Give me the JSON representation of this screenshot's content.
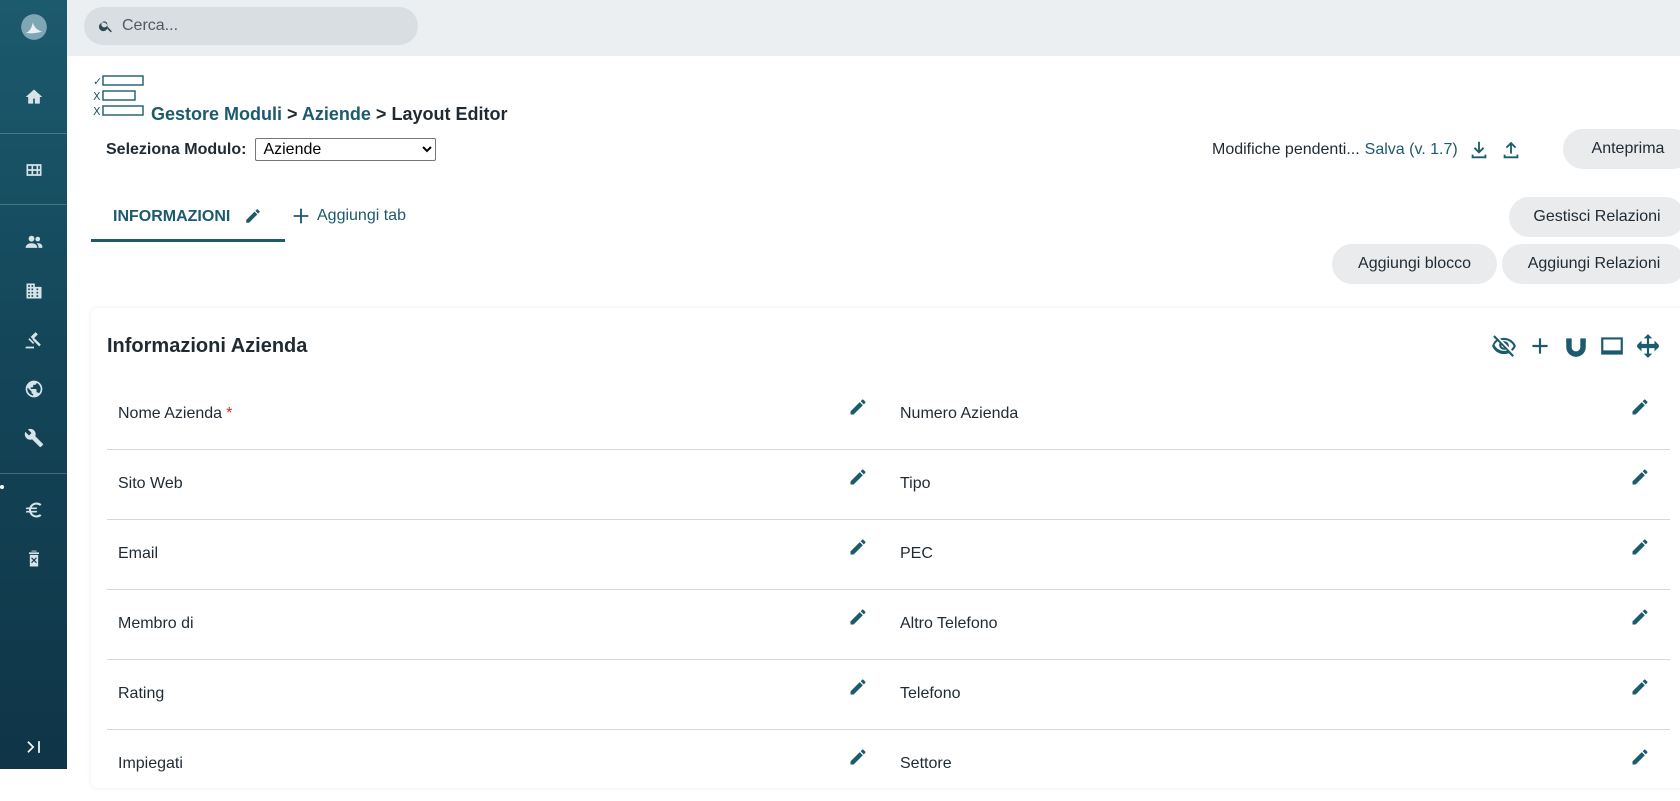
{
  "topbar": {
    "search_placeholder": "Cerca..."
  },
  "sidebar": {
    "items": [
      {
        "icon": "home-icon"
      },
      {
        "icon": "grid-icon"
      },
      {
        "icon": "people-icon"
      },
      {
        "icon": "building-icon"
      },
      {
        "icon": "gavel-icon"
      },
      {
        "icon": "globe-icon"
      },
      {
        "icon": "wrench-icon"
      },
      {
        "icon": "euro-icon"
      },
      {
        "icon": "trash-icon"
      }
    ],
    "collapse_icon": "collapse-right-icon"
  },
  "header": {
    "breadcrumb": [
      {
        "label": "Gestore Moduli"
      },
      {
        "sep": ">"
      },
      {
        "label": "Aziende"
      },
      {
        "sep": ">"
      },
      {
        "label": "Layout Editor"
      }
    ],
    "select_label": "Seleziona Modulo:",
    "select_value": "Aziende",
    "pending_text": "Modifiche pendenti...",
    "save_link": "Salva (v. 1.7)",
    "preview_button": "Anteprima",
    "manage_relations_button": "Gestisci Relazioni",
    "add_block_button": "Aggiungi blocco",
    "add_relations_button": "Aggiungi Relazioni"
  },
  "tabs": {
    "active": "INFORMAZIONI",
    "add_tab": "Aggiungi tab"
  },
  "block": {
    "title": "Informazioni Azienda",
    "rows": [
      {
        "left": "Nome Azienda",
        "left_required": "*",
        "right": "Numero Azienda"
      },
      {
        "left": "Sito Web",
        "right": "Tipo"
      },
      {
        "left": "Email",
        "right": "PEC"
      },
      {
        "left": "Membro di",
        "right": "Altro Telefono"
      },
      {
        "left": "Rating",
        "right": "Telefono"
      },
      {
        "left": "Impiegati",
        "right": "Settore"
      }
    ]
  },
  "colors": {
    "accent": "#1c5a6e",
    "sidebar": "#144659",
    "required": "#e02020"
  }
}
